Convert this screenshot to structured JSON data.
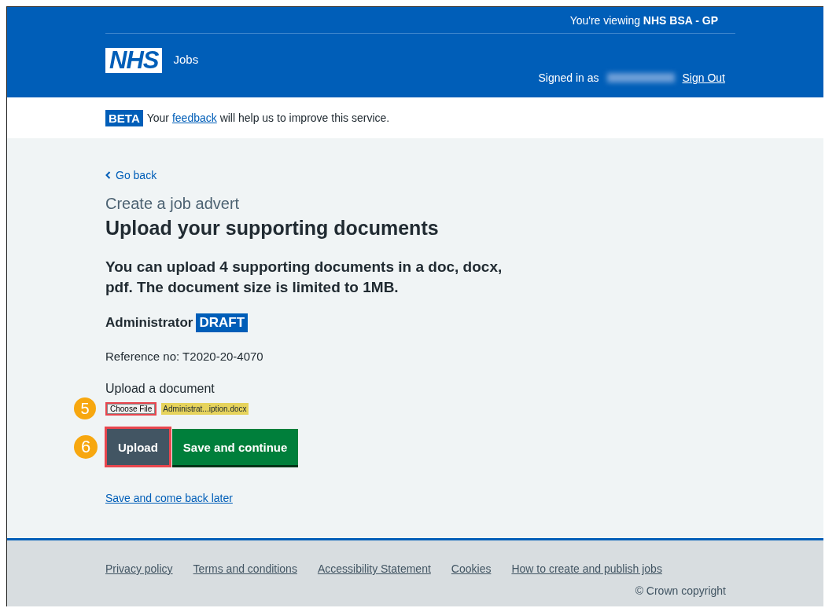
{
  "header": {
    "viewing_prefix": "You're viewing",
    "viewing_org": "NHS BSA - GP",
    "logo": "NHS",
    "service": "Jobs",
    "signed_in_label": "Signed in as",
    "user_name_redacted": true,
    "sign_out": "Sign Out"
  },
  "phase_banner": {
    "tag": "BETA",
    "text_before": "Your",
    "link": "feedback",
    "text_after": "will help us to improve this service."
  },
  "back_link": "Go back",
  "caption": "Create a job advert",
  "heading": "Upload your supporting documents",
  "intro": "You can upload 4 supporting documents in a doc, docx, pdf. The document size is limited to 1MB.",
  "job": {
    "title": "Administrator",
    "status": "DRAFT"
  },
  "reference": "Reference no: T2020-20-4070",
  "upload": {
    "label": "Upload a document",
    "step": "5",
    "button": "Choose File",
    "button_highlighted": true,
    "file_name": "Administrat...iption.docx",
    "file_highlighted": true
  },
  "buttons": [
    {
      "label": "Upload",
      "kind": "secondary",
      "step": "6",
      "highlighted": true
    },
    {
      "label": "Save and continue",
      "kind": "primary",
      "highlighted": false
    }
  ],
  "save_later": "Save and come back later",
  "footer": {
    "links": [
      "Privacy policy",
      "Terms and conditions",
      "Accessibility Statement",
      "Cookies",
      "How to create and publish jobs"
    ],
    "copyright": "© Crown copyright"
  }
}
